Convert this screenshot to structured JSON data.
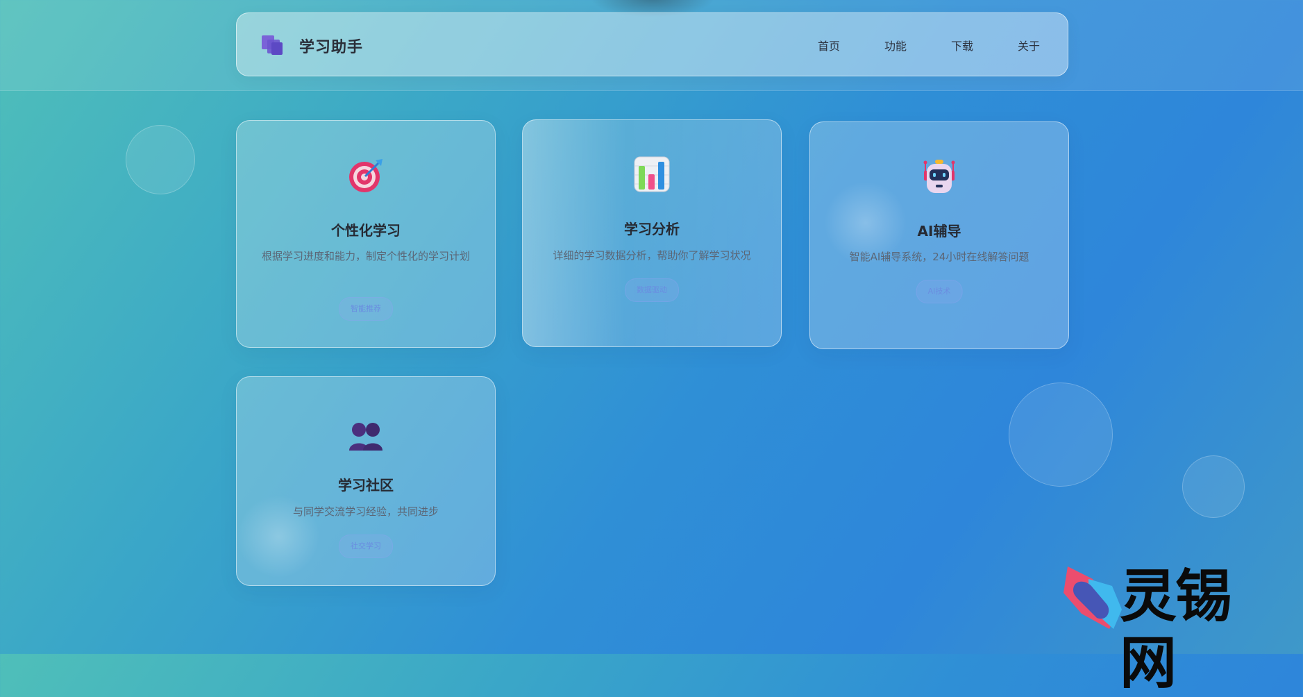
{
  "header": {
    "brand": "学习助手",
    "nav": [
      {
        "label": "首页"
      },
      {
        "label": "功能"
      },
      {
        "label": "下载"
      },
      {
        "label": "关于"
      }
    ]
  },
  "cards": [
    {
      "icon": "target-icon",
      "title": "个性化学习",
      "desc": "根据学习进度和能力，制定个性化的学习计划",
      "tag": "智能推荐"
    },
    {
      "icon": "bar-chart-icon",
      "title": "学习分析",
      "desc": "详细的学习数据分析，帮助你了解学习状况",
      "tag": "数据驱动"
    },
    {
      "icon": "robot-icon",
      "title": "AI辅导",
      "desc": "智能AI辅导系统，24小时在线解答问题",
      "tag": "AI技术"
    },
    {
      "icon": "people-icon",
      "title": "学习社区",
      "desc": "与同学交流学习经验，共同进步",
      "tag": "社交学习"
    }
  ],
  "watermark": {
    "text": "灵锡网"
  },
  "colors": {
    "accent": "#6a8de0",
    "logo": "#6b5bd6"
  }
}
